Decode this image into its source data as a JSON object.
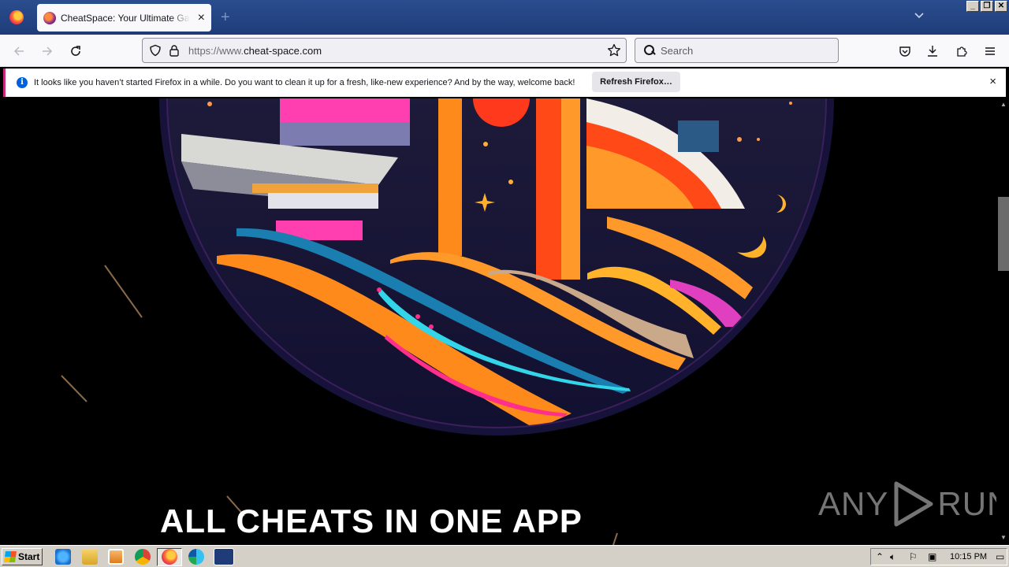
{
  "browser": {
    "tab": {
      "title": "CheatSpace: Your Ultimate Game Cheats",
      "close": "×"
    },
    "new_tab": "+",
    "window_buttons": {
      "minimize": "_",
      "restore": "❐",
      "close": "✕"
    },
    "url": {
      "prefix": "https://www.",
      "domain": "cheat-space.com"
    },
    "search_placeholder": "Search"
  },
  "notification": {
    "message": "It looks like you haven’t started Firefox in a while. Do you want to clean it up for a fresh, like-new experience? And by the way, welcome back!",
    "button": "Refresh Firefox…",
    "close": "×"
  },
  "page": {
    "hero_title": "ALL CHEATS IN ONE APP"
  },
  "watermark": {
    "left": "ANY",
    "right": "RUN"
  },
  "taskbar": {
    "start": "Start",
    "clock": "10:15 PM"
  }
}
